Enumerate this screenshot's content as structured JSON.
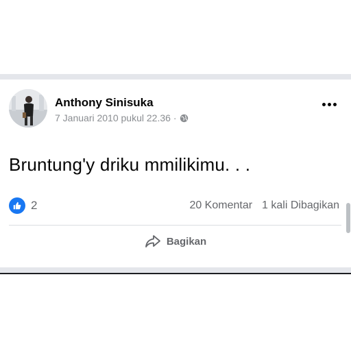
{
  "post": {
    "author": "Anthony Sinisuka",
    "timestamp": "7 Januari 2010 pukul 22.36",
    "separator": "·",
    "privacy_icon": "globe-icon",
    "text": "Bruntung'y driku mmilikimu. . .",
    "reactions": {
      "icon": "like-icon",
      "count": "2"
    },
    "comments": "20 Komentar",
    "shares": "1 kali Dibagikan",
    "share_label": "Bagikan"
  },
  "colors": {
    "like_blue": "#1877f2",
    "secondary_text": "#65676b",
    "divider": "#e4e6eb"
  }
}
